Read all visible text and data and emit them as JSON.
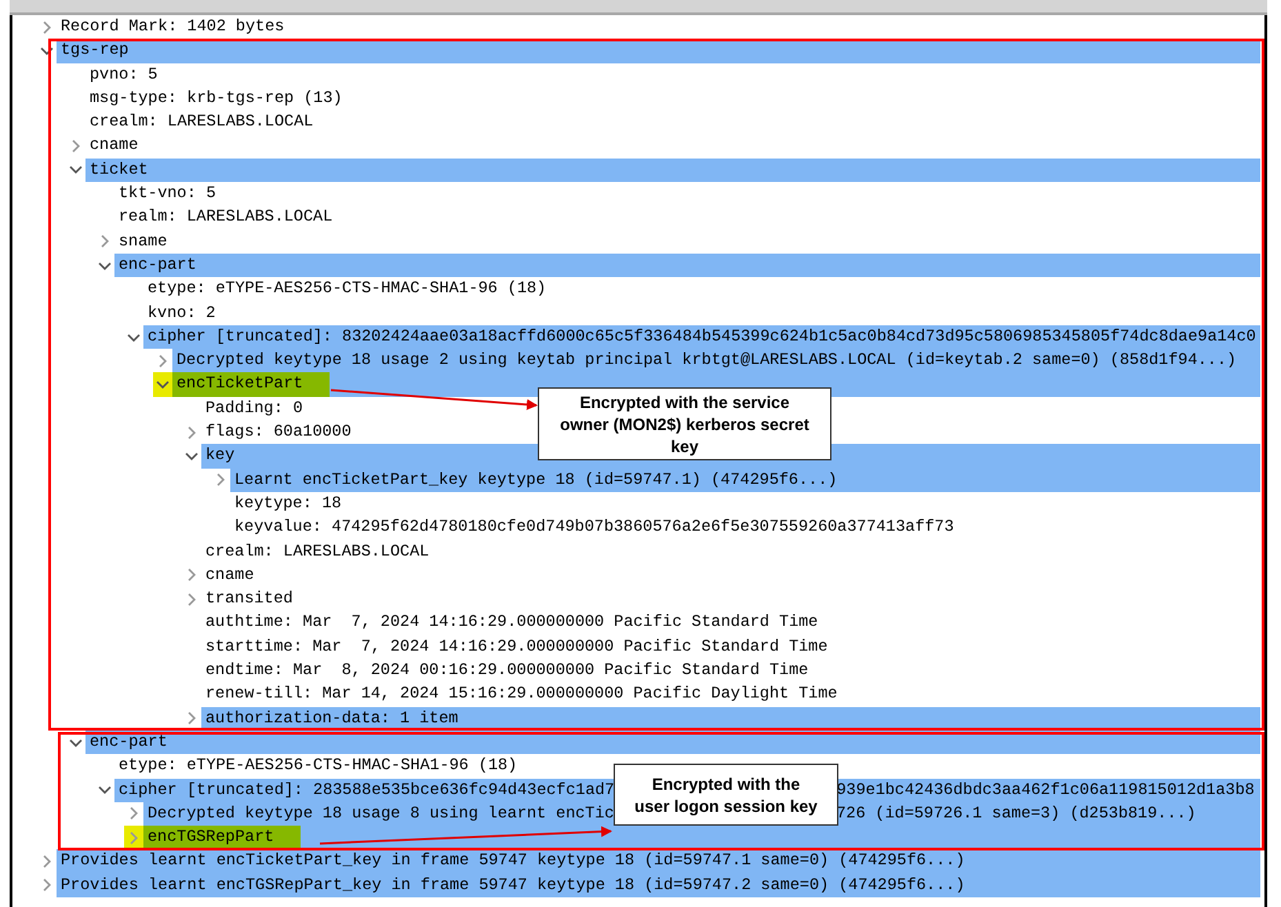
{
  "tree": [
    {
      "text": "Record Mark: 1402 bytes",
      "expanded": false,
      "selected": false,
      "marked": false
    },
    {
      "text": "tgs-rep",
      "expanded": true,
      "selected": true,
      "marked": false,
      "children": [
        {
          "text": "pvno: 5",
          "selected": false,
          "marked": false
        },
        {
          "text": "msg-type: krb-tgs-rep (13)",
          "selected": false,
          "marked": false
        },
        {
          "text": "crealm: LARESLABS.LOCAL",
          "selected": false,
          "marked": false
        },
        {
          "text": "cname",
          "expanded": false,
          "selected": false,
          "marked": false
        },
        {
          "text": "ticket",
          "expanded": true,
          "selected": true,
          "marked": false,
          "children": [
            {
              "text": "tkt-vno: 5",
              "selected": false,
              "marked": false
            },
            {
              "text": "realm: LARESLABS.LOCAL",
              "selected": false,
              "marked": false
            },
            {
              "text": "sname",
              "expanded": false,
              "selected": false,
              "marked": false
            },
            {
              "text": "enc-part",
              "expanded": true,
              "selected": true,
              "marked": false,
              "children": [
                {
                  "text": "etype: eTYPE-AES256-CTS-HMAC-SHA1-96 (18)",
                  "selected": false,
                  "marked": false
                },
                {
                  "text": "kvno: 2",
                  "selected": false,
                  "marked": false
                },
                {
                  "text": "cipher [truncated]: 83202424aae03a18acffd6000c65c5f336484b545399c624b1c5ac0b84cd73d95c5806985345805f74dc8dae9a14c0",
                  "expanded": true,
                  "selected": true,
                  "marked": false,
                  "children": [
                    {
                      "text": "Decrypted keytype 18 usage 2 using keytab principal krbtgt@LARESLABS.LOCAL (id=keytab.2 same=0) (858d1f94...)",
                      "expanded": false,
                      "selected": true,
                      "marked": false
                    },
                    {
                      "text": "encTicketPart",
                      "expanded": true,
                      "selected": true,
                      "marked": true,
                      "children": [
                        {
                          "text": "Padding: 0",
                          "selected": false,
                          "marked": false
                        },
                        {
                          "text": "flags: 60a10000",
                          "expanded": false,
                          "selected": false,
                          "marked": false
                        },
                        {
                          "text": "key",
                          "expanded": true,
                          "selected": true,
                          "marked": false,
                          "children": [
                            {
                              "text": "Learnt encTicketPart_key keytype 18 (id=59747.1) (474295f6...)",
                              "expanded": false,
                              "selected": true,
                              "marked": false
                            },
                            {
                              "text": "keytype: 18",
                              "selected": false,
                              "marked": false
                            },
                            {
                              "text": "keyvalue: 474295f62d4780180cfe0d749b07b3860576a2e6f5e307559260a377413aff73",
                              "selected": false,
                              "marked": false
                            }
                          ]
                        },
                        {
                          "text": "crealm: LARESLABS.LOCAL",
                          "selected": false,
                          "marked": false
                        },
                        {
                          "text": "cname",
                          "expanded": false,
                          "selected": false,
                          "marked": false
                        },
                        {
                          "text": "transited",
                          "expanded": false,
                          "selected": false,
                          "marked": false
                        },
                        {
                          "text": "authtime: Mar  7, 2024 14:16:29.000000000 Pacific Standard Time",
                          "selected": false,
                          "marked": false
                        },
                        {
                          "text": "starttime: Mar  7, 2024 14:16:29.000000000 Pacific Standard Time",
                          "selected": false,
                          "marked": false
                        },
                        {
                          "text": "endtime: Mar  8, 2024 00:16:29.000000000 Pacific Standard Time",
                          "selected": false,
                          "marked": false
                        },
                        {
                          "text": "renew-till: Mar 14, 2024 15:16:29.000000000 Pacific Daylight Time",
                          "selected": false,
                          "marked": false
                        },
                        {
                          "text": "authorization-data: 1 item",
                          "expanded": false,
                          "selected": true,
                          "marked": false
                        }
                      ]
                    }
                  ]
                }
              ]
            }
          ]
        },
        {
          "text": "enc-part",
          "expanded": true,
          "selected": true,
          "marked": false,
          "children": [
            {
              "text": "etype: eTYPE-AES256-CTS-HMAC-SHA1-96 (18)",
              "selected": false,
              "marked": false
            },
            {
              "text": "cipher [truncated]: 283588e535bce636fc94d43ecfc1ad7",
              "tail": "939e1bc42436dbdc3aa462f1c06a119815012d1a3b8",
              "expanded": true,
              "selected": true,
              "marked": false,
              "children": [
                {
                  "text": "Decrypted keytype 18 usage 8 using learnt encTic",
                  "tail": "726 (id=59726.1 same=3) (d253b819...)",
                  "expanded": false,
                  "selected": true,
                  "marked": false
                },
                {
                  "text": "encTGSRepPart",
                  "expanded": false,
                  "selected": true,
                  "marked": true
                }
              ]
            }
          ]
        }
      ]
    },
    {
      "text": "Provides learnt encTicketPart_key in frame 59747 keytype 18 (id=59747.1 same=0) (474295f6...)",
      "expanded": false,
      "selected": true,
      "marked": false
    },
    {
      "text": "Provides learnt encTGSRepPart_key in frame 59747 keytype 18 (id=59747.2 same=0) (474295f6...)",
      "expanded": false,
      "selected": true,
      "marked": false
    }
  ],
  "annotations": [
    {
      "text": "Encrypted with the service owner (MON2$) kerberos secret key"
    },
    {
      "text": "Encrypted with the user logon session key"
    }
  ]
}
